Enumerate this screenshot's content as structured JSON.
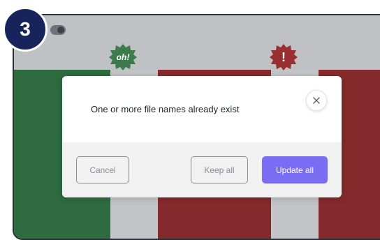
{
  "step": {
    "number": "3"
  },
  "background": {
    "badges": [
      {
        "icon": "ok-sticker-icon",
        "text": "oh!",
        "color": "#3d7a4c"
      },
      {
        "icon": "warning-sticker-icon",
        "text": "!",
        "color": "#9a2f31"
      }
    ],
    "colors": {
      "green": "#2e6b3f",
      "red": "#842a2c",
      "gray": "#c3c5c8"
    }
  },
  "dialog": {
    "message": "One or more file names already exist",
    "close_icon": "close-icon",
    "buttons": {
      "cancel": "Cancel",
      "keep_all": "Keep all",
      "update_all": "Update all"
    },
    "accent": "#7a6cf3"
  }
}
